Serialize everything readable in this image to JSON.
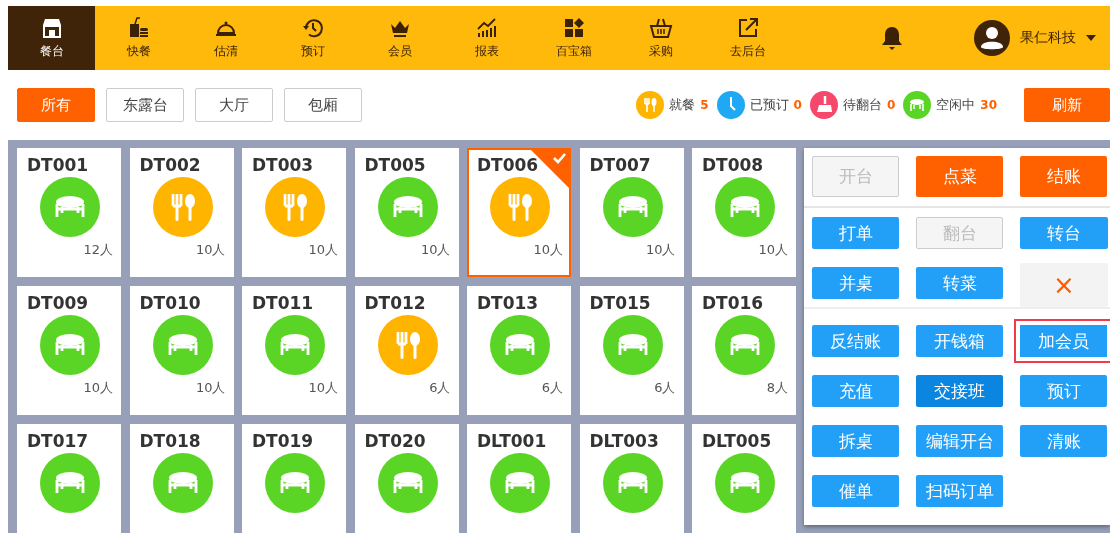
{
  "nav": {
    "items": [
      {
        "label": "餐台",
        "selected": true
      },
      {
        "label": "快餐",
        "selected": false
      },
      {
        "label": "估清",
        "selected": false
      },
      {
        "label": "预订",
        "selected": false
      },
      {
        "label": "会员",
        "selected": false
      },
      {
        "label": "报表",
        "selected": false
      },
      {
        "label": "百宝箱",
        "selected": false
      },
      {
        "label": "采购",
        "selected": false
      },
      {
        "label": "去后台",
        "selected": false
      }
    ],
    "user": "果仁科技"
  },
  "areas": [
    {
      "label": "所有",
      "selected": true
    },
    {
      "label": "东露台",
      "selected": false
    },
    {
      "label": "大厅",
      "selected": false
    },
    {
      "label": "包厢",
      "selected": false
    }
  ],
  "stats": [
    {
      "kind": "dining",
      "label": "就餐",
      "count": "5",
      "color": "#ffb400"
    },
    {
      "kind": "reserved",
      "label": "已预订",
      "count": "0",
      "color": "#1fa9f5"
    },
    {
      "kind": "cleaning",
      "label": "待翻台",
      "count": "0",
      "color": "#f5486b"
    },
    {
      "kind": "free",
      "label": "空闲中",
      "count": "30",
      "color": "#5bd525"
    }
  ],
  "refresh": "刷新",
  "tables": [
    {
      "name": "DT001",
      "kind": "free",
      "seats": "12人",
      "selected": false
    },
    {
      "name": "DT002",
      "kind": "dining",
      "seats": "10人",
      "selected": false
    },
    {
      "name": "DT003",
      "kind": "dining",
      "seats": "10人",
      "selected": false
    },
    {
      "name": "DT005",
      "kind": "free",
      "seats": "10人",
      "selected": false
    },
    {
      "name": "DT006",
      "kind": "dining",
      "seats": "10人",
      "selected": true
    },
    {
      "name": "DT007",
      "kind": "free",
      "seats": "10人",
      "selected": false
    },
    {
      "name": "DT008",
      "kind": "free",
      "seats": "10人",
      "selected": false
    },
    {
      "name": "DT009",
      "kind": "free",
      "seats": "10人",
      "selected": false
    },
    {
      "name": "DT010",
      "kind": "free",
      "seats": "10人",
      "selected": false
    },
    {
      "name": "DT011",
      "kind": "free",
      "seats": "10人",
      "selected": false
    },
    {
      "name": "DT012",
      "kind": "dining",
      "seats": "6人",
      "selected": false
    },
    {
      "name": "DT013",
      "kind": "free",
      "seats": "6人",
      "selected": false
    },
    {
      "name": "DT015",
      "kind": "free",
      "seats": "6人",
      "selected": false
    },
    {
      "name": "DT016",
      "kind": "free",
      "seats": "8人",
      "selected": false
    },
    {
      "name": "DT017",
      "kind": "free",
      "selected": false
    },
    {
      "name": "DT018",
      "kind": "free",
      "selected": false
    },
    {
      "name": "DT019",
      "kind": "free",
      "selected": false
    },
    {
      "name": "DT020",
      "kind": "free",
      "selected": false
    },
    {
      "name": "DLT001",
      "kind": "free",
      "selected": false
    },
    {
      "name": "DLT003",
      "kind": "free",
      "selected": false
    },
    {
      "name": "DLT005",
      "kind": "free",
      "selected": false
    }
  ],
  "actions": {
    "main": [
      {
        "label": "开台",
        "kind": "orange",
        "disabled": true
      },
      {
        "label": "点菜",
        "kind": "orange",
        "disabled": false
      },
      {
        "label": "结账",
        "kind": "orange",
        "disabled": false
      }
    ],
    "quick": [
      {
        "label": "打单",
        "kind": "blue",
        "disabled": false
      },
      {
        "label": "翻台",
        "kind": "blue",
        "disabled": true
      },
      {
        "label": "转台",
        "kind": "blue",
        "disabled": false
      },
      {
        "label": "并桌",
        "kind": "blue",
        "disabled": false
      },
      {
        "label": "转菜",
        "kind": "blue",
        "disabled": false
      },
      {
        "label": "×",
        "kind": "close"
      }
    ],
    "more": [
      {
        "label": "反结账",
        "pressed": false,
        "highlighted": false
      },
      {
        "label": "开钱箱",
        "pressed": false,
        "highlighted": false
      },
      {
        "label": "加会员",
        "pressed": false,
        "highlighted": true
      },
      {
        "label": "充值",
        "pressed": false,
        "highlighted": false
      },
      {
        "label": "交接班",
        "pressed": true,
        "highlighted": false
      },
      {
        "label": "预订",
        "pressed": false,
        "highlighted": false
      },
      {
        "label": "拆桌",
        "pressed": false,
        "highlighted": false
      },
      {
        "label": "编辑开台",
        "pressed": false,
        "highlighted": false
      },
      {
        "label": "清账",
        "pressed": false,
        "highlighted": false
      },
      {
        "label": "催单",
        "pressed": false,
        "highlighted": false
      },
      {
        "label": "扫码订单",
        "pressed": false,
        "highlighted": false
      }
    ]
  }
}
